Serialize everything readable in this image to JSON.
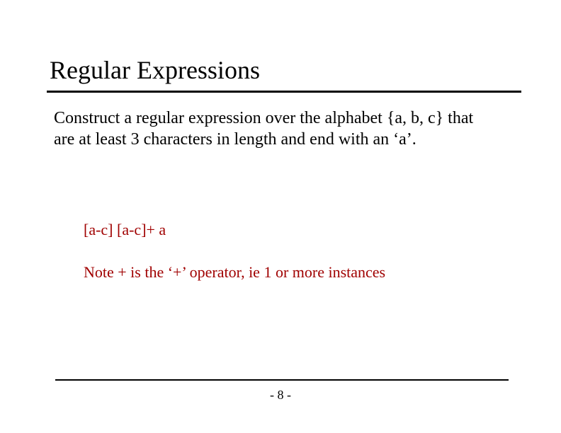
{
  "title": "Regular Expressions",
  "body": "Construct a regular expression over the alphabet {a, b, c} that are at least 3 characters in length and end with an ‘a’.",
  "answer": "[a-c] [a-c]+ a",
  "note": "Note + is the ‘+’ operator, ie 1 or more instances",
  "page": "- 8 -"
}
